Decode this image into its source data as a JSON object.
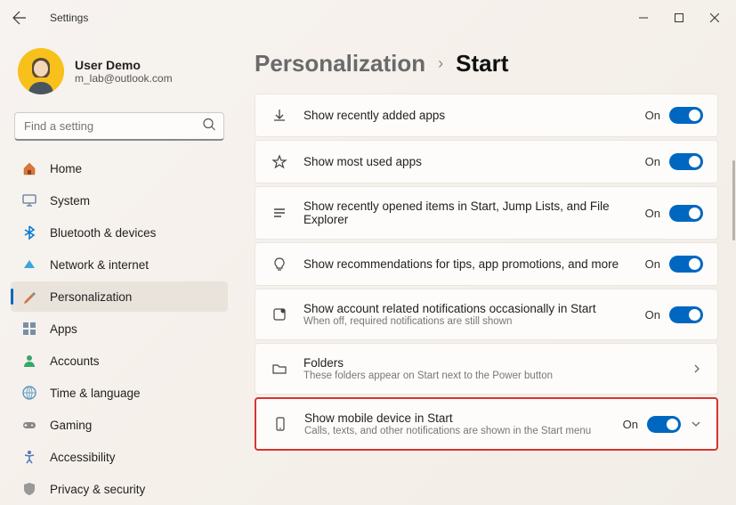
{
  "titlebar": {
    "title": "Settings"
  },
  "user": {
    "name": "User Demo",
    "email": "m_lab@outlook.com"
  },
  "search": {
    "placeholder": "Find a setting"
  },
  "nav": {
    "items": [
      {
        "label": "Home"
      },
      {
        "label": "System"
      },
      {
        "label": "Bluetooth & devices"
      },
      {
        "label": "Network & internet"
      },
      {
        "label": "Personalization"
      },
      {
        "label": "Apps"
      },
      {
        "label": "Accounts"
      },
      {
        "label": "Time & language"
      },
      {
        "label": "Gaming"
      },
      {
        "label": "Accessibility"
      },
      {
        "label": "Privacy & security"
      }
    ]
  },
  "breadcrumb": {
    "parent": "Personalization",
    "current": "Start"
  },
  "settings": {
    "recent_apps": {
      "title": "Show recently added apps",
      "state": "On"
    },
    "most_used": {
      "title": "Show most used apps",
      "state": "On"
    },
    "recent_items": {
      "title": "Show recently opened items in Start, Jump Lists, and File Explorer",
      "state": "On"
    },
    "recommendations": {
      "title": "Show recommendations for tips, app promotions, and more",
      "state": "On"
    },
    "account_notif": {
      "title": "Show account related notifications occasionally in Start",
      "sub": "When off, required notifications are still shown",
      "state": "On"
    },
    "folders": {
      "title": "Folders",
      "sub": "These folders appear on Start next to the Power button"
    },
    "mobile": {
      "title": "Show mobile device in Start",
      "sub": "Calls, texts, and other notifications are shown in the Start menu",
      "state": "On"
    }
  }
}
